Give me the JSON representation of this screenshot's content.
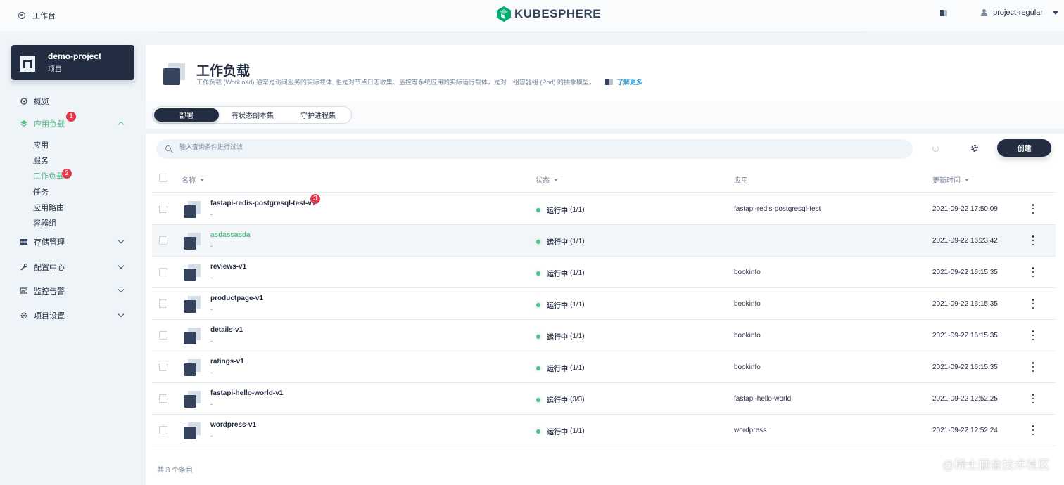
{
  "topbar": {
    "workspace_label": "工作台",
    "brand": "KUBESPHERE",
    "username": "project-regular"
  },
  "project": {
    "name": "demo-project",
    "type": "项目"
  },
  "nav": {
    "overview": "概览",
    "app_workloads": "应用负载",
    "sub": [
      "应用",
      "服务",
      "工作负载",
      "任务",
      "应用路由",
      "容器组"
    ],
    "storage": "存储管理",
    "config": "配置中心",
    "monitoring": "监控告警",
    "settings": "项目设置"
  },
  "badges": {
    "b1": "1",
    "b2": "2",
    "b3": "3"
  },
  "header": {
    "title": "工作负载",
    "description": "工作负载 (Workload) 通常是访问服务的实际载体, 也是对节点日志收集、监控等系统应用的实际运行载体，是对一组容器组 (Pod) 的抽象模型。",
    "learn_more": "了解更多"
  },
  "tabs": [
    "部署",
    "有状态副本集",
    "守护进程集"
  ],
  "toolbar": {
    "search_placeholder": "输入查询条件进行过滤",
    "create_label": "创建"
  },
  "table": {
    "headers": {
      "name": "名称",
      "status": "状态",
      "app": "应用",
      "updated": "更新时间"
    },
    "rows": [
      {
        "name": "fastapi-redis-postgresql-test-v1",
        "sub": "-",
        "status": "运行中",
        "count": "(1/1)",
        "app": "fastapi-redis-postgresql-test",
        "time": "2021-09-22 17:50:09"
      },
      {
        "name": "asdassasda",
        "sub": "-",
        "status": "运行中",
        "count": "(1/1)",
        "app": "",
        "time": "2021-09-22 16:23:42"
      },
      {
        "name": "reviews-v1",
        "sub": "-",
        "status": "运行中",
        "count": "(1/1)",
        "app": "bookinfo",
        "time": "2021-09-22 16:15:35"
      },
      {
        "name": "productpage-v1",
        "sub": "-",
        "status": "运行中",
        "count": "(1/1)",
        "app": "bookinfo",
        "time": "2021-09-22 16:15:35"
      },
      {
        "name": "details-v1",
        "sub": "-",
        "status": "运行中",
        "count": "(1/1)",
        "app": "bookinfo",
        "time": "2021-09-22 16:15:35"
      },
      {
        "name": "ratings-v1",
        "sub": "-",
        "status": "运行中",
        "count": "(1/1)",
        "app": "bookinfo",
        "time": "2021-09-22 16:15:35"
      },
      {
        "name": "fastapi-hello-world-v1",
        "sub": "-",
        "status": "运行中",
        "count": "(3/3)",
        "app": "fastapi-hello-world",
        "time": "2021-09-22 12:52:25"
      },
      {
        "name": "wordpress-v1",
        "sub": "-",
        "status": "运行中",
        "count": "(1/1)",
        "app": "wordpress",
        "time": "2021-09-22 12:52:24"
      }
    ],
    "total": "共 8 个条目"
  },
  "watermark": "@稀土掘金技术社区",
  "colors": {
    "primary": "#242e42",
    "accent": "#55bc8a",
    "badge": "#e2384a",
    "link": "#329dce"
  }
}
